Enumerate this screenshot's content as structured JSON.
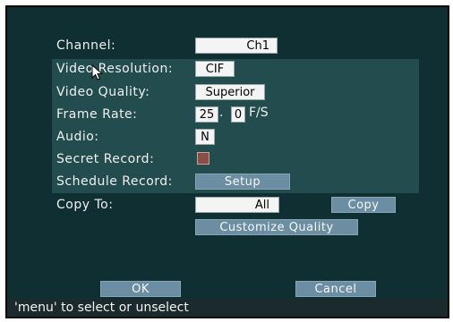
{
  "settings": {
    "channel": {
      "label": "Channel:",
      "value": "Ch1"
    },
    "video_resolution": {
      "label": "Video Resolution:",
      "value": "CIF"
    },
    "video_quality": {
      "label": "Video Quality:",
      "value": "Superior"
    },
    "frame_rate": {
      "label": "Frame Rate:",
      "integer": "25",
      "separator": ".",
      "decimal": "0",
      "unit": "F/S"
    },
    "audio": {
      "label": "Audio:",
      "value": "N"
    },
    "secret_record": {
      "label": "Secret Record:",
      "checked_color": "#8b4e46"
    },
    "schedule_record": {
      "label": "Schedule Record:",
      "button": "Setup"
    },
    "copy_to": {
      "label": "Copy To:",
      "value": "All",
      "button": "Copy"
    },
    "customize_quality": {
      "button": "Customize Quality"
    }
  },
  "actions": {
    "ok": "OK",
    "cancel": "Cancel"
  },
  "status": {
    "text": "'menu' to select or unselect"
  }
}
